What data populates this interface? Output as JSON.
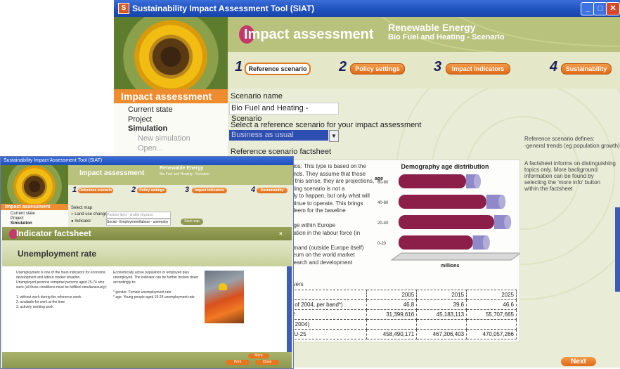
{
  "main_window": {
    "title": "Sustainability Impact Assessment Tool (SIAT)",
    "app_icon_letter": "S",
    "header": {
      "title": "Impact assessment",
      "domain": "Renewable Energy",
      "scenario": "Bio Fuel and Heating - Scenario"
    },
    "steps": [
      {
        "num": "1",
        "label": "Reference scenario"
      },
      {
        "num": "2",
        "label": "Policy settings"
      },
      {
        "num": "3",
        "label": "Impact indicators"
      },
      {
        "num": "4",
        "label": "Sustainability"
      }
    ],
    "sidebar": {
      "header": "Impact assessment",
      "items": [
        "Current state",
        "Project",
        "Simulation",
        "New simulation",
        "Open..."
      ]
    },
    "form": {
      "scenario_name_label": "Scenario name",
      "scenario_name_value": "Bio Fuel and Heating - Scenario",
      "select_label": "Select a reference scenario for your impact assessment",
      "select_value": "Business as usual",
      "factsheet_label": "Reference scenario factsheet"
    },
    "factsheet": {
      "text_lines": [
        "nios: This type is based on the",
        "ends. They assume that those",
        "n this sense, they are projections,",
        "sting scenario is not a",
        "ely to happen, but only what will",
        "ntinue to operate. This brings",
        "bleem for the baseline",
        "",
        "nge within Europe",
        "pation in the labour force (in",
        "",
        "emand (outside Europe itself)",
        "lieum on the world market",
        "nearch and development"
      ],
      "table_header_label": "livers",
      "table": {
        "header": [
          "",
          "2005",
          "2015",
          "2025"
        ],
        "rows": [
          [
            "s of 2004, per band*)",
            "46.8",
            "39.6",
            "46.6"
          ],
          [
            "t2",
            "31,399,616",
            "45,183,113",
            "55,707,665"
          ],
          [
            "d 2004)",
            "",
            "",
            ""
          ],
          [
            "EU-25",
            "458,490,171",
            "467,306,403",
            "470,057,266"
          ]
        ]
      }
    },
    "info_text": {
      "line1": "Reference scenario defines:",
      "line2": "-general trends (eg population growth)",
      "block": "A factsheet informs on distinguishing topics only. More background information can be found by selecting the 'more info' button within the factsheet"
    },
    "next_label": "Next"
  },
  "chart_data": {
    "type": "bar",
    "title": "Demography age distribution",
    "ylabel": "age",
    "xlabel": "millions",
    "y_tick_labels": [
      "0-20",
      "20-40",
      "40-60",
      "60-80"
    ],
    "orientation": "horizontal-3d",
    "categories": [
      "60-80",
      "40-60",
      "20-40",
      "0-20"
    ],
    "series": [
      {
        "values": [
          60,
          78,
          85,
          66
        ],
        "color": "#8b1f4a"
      },
      {
        "values": [
          10,
          14,
          12,
          12
        ],
        "color": "#8f88c9"
      }
    ],
    "grid": false
  },
  "front_window": {
    "title": "Sustainability Impact Assessment Tool (SIAT)",
    "header": {
      "title": "Impact assessment",
      "domain": "Renewable Energy",
      "scenario": "Bio Fuel and Heating - Scenario"
    },
    "steps": [
      "Reference scenario",
      "Policy settings",
      "Impact indicators",
      "Sustainability"
    ],
    "sidebar": {
      "header": "Impact assessment",
      "items": [
        "Current state",
        "Project",
        "Simulation"
      ]
    },
    "map_select": {
      "label": "Select map",
      "option1": "Land use change",
      "option1_value": "Pasture land - arable (bypass",
      "option2": "Indicator",
      "option2_value": "Social - Employment/labour - unemploy",
      "button": "Start map"
    },
    "indicator": {
      "bar_title": "Indicator factsheet",
      "title": "Unemployment rate",
      "col1_lines": [
        "Unemployment is one of the main indicators for economic",
        "development and labour market situation.",
        "Unemployed persons comprise persons aged 15-74 who",
        "were (all three conditions must be fulfilled simultaneously):",
        "",
        "1. without work during the reference week",
        "2. available for work at the time",
        "3. actively seeking work"
      ],
      "col2_lines": [
        "Economically active population or employed plus",
        "unemployed. The indicator can be further broken down",
        "accordingly to:",
        "",
        "* gender: Female unemployment rate",
        "* age: Young people aged 15-24 unemployment rate"
      ],
      "more_info": "More",
      "btn_a": "Print",
      "btn_b": "Close"
    }
  }
}
